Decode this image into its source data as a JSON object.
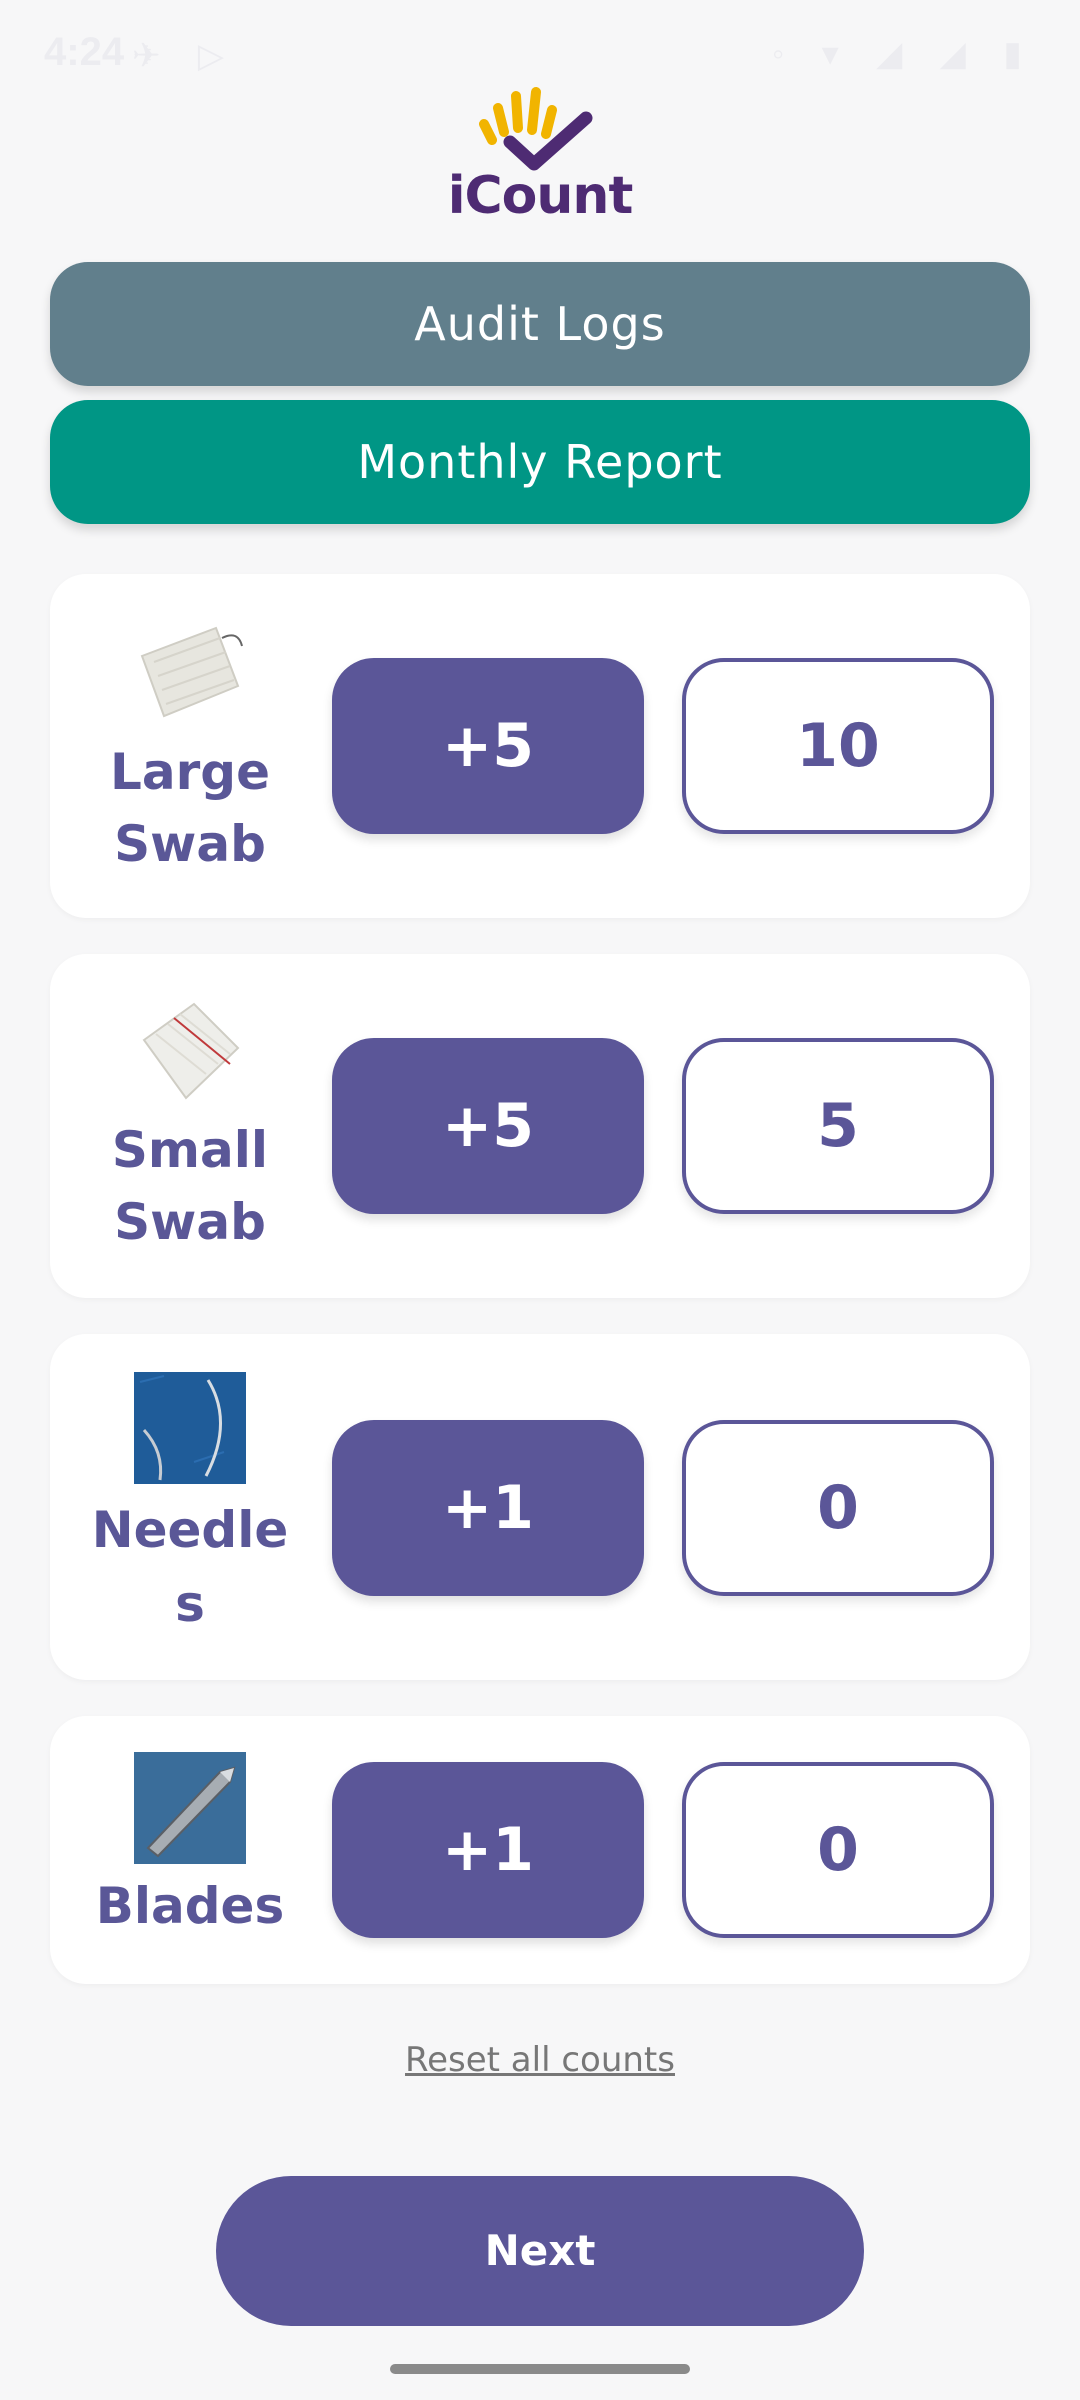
{
  "status_bar": {
    "time": "4:24",
    "left_icons": "✈ ▷",
    "right_icons": "◦ ▾ ◢ ◢ ▮"
  },
  "app": {
    "logo_text": "iCount"
  },
  "buttons": {
    "audit_logs": "Audit Logs",
    "monthly_report": "Monthly Report",
    "reset": "Reset all counts",
    "next": "Next"
  },
  "items": [
    {
      "label_line1": "Large",
      "label_line2": "Swab",
      "increment": "+5",
      "count": "10"
    },
    {
      "label_line1": "Small",
      "label_line2": "Swab",
      "increment": "+5",
      "count": "5"
    },
    {
      "label_line1": "Needle",
      "label_line2": "s",
      "increment": "+1",
      "count": "0"
    },
    {
      "label_line1": "Blades",
      "increment": "+1",
      "count": "0"
    }
  ],
  "colors": {
    "primary": "#5b5698",
    "audit_button": "#617f8c",
    "monthly_button": "#009685",
    "logo_yellow": "#f1b400",
    "logo_purple": "#4e2b73"
  }
}
